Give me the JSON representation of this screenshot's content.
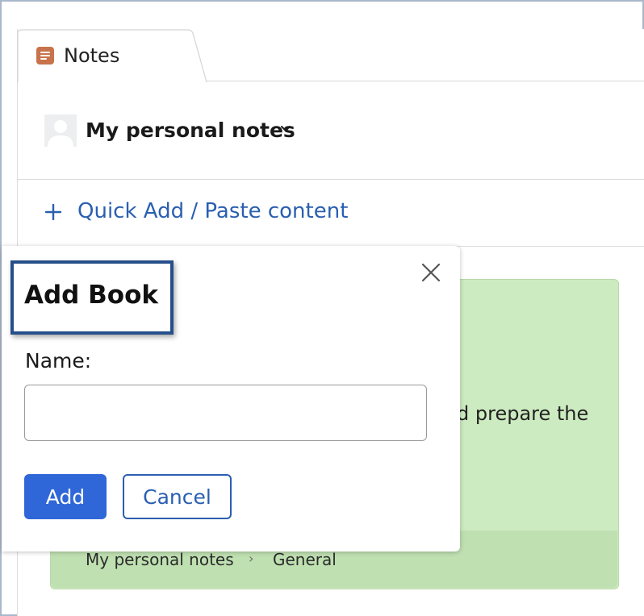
{
  "tab": {
    "label": "Notes",
    "icon": "notes-icon"
  },
  "header": {
    "notebook_title": "My personal notes",
    "avatar_icon": "user-avatar-icon",
    "dropdown_icon": "chevron-down-icon"
  },
  "quick_add": {
    "label": "Quick Add / Paste content",
    "icon": "plus-icon"
  },
  "note": {
    "visible_text": "d prepare the",
    "breadcrumb": {
      "notebook": "My personal notes",
      "separator": "›",
      "book": "General"
    }
  },
  "dialog": {
    "title": "Add Book",
    "name_label": "Name:",
    "name_value": "",
    "add_label": "Add",
    "cancel_label": "Cancel",
    "close_icon": "close-icon"
  },
  "colors": {
    "accent": "#2f67d8",
    "link": "#2a5fb0",
    "note_bg": "#cdebc0",
    "highlight_border": "#264f8a",
    "tab_icon": "#c8734b"
  }
}
